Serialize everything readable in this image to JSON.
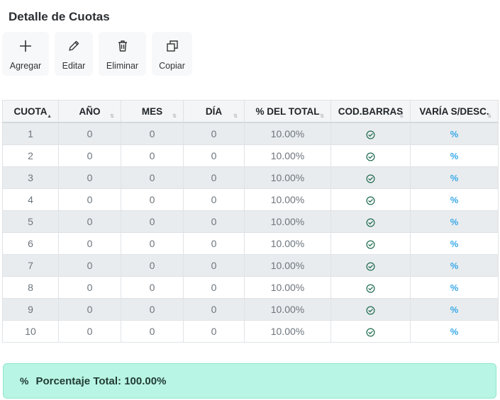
{
  "page": {
    "title": "Detalle de Cuotas"
  },
  "toolbar": {
    "buttons": [
      {
        "label": "Agregar",
        "icon": "plus-icon"
      },
      {
        "label": "Editar",
        "icon": "pencil-icon"
      },
      {
        "label": "Eliminar",
        "icon": "trash-icon"
      },
      {
        "label": "Copiar",
        "icon": "copy-icon"
      }
    ]
  },
  "table": {
    "headers": [
      "CUOTA",
      "AÑO",
      "MES",
      "DÍA",
      "% DEL TOTAL",
      "COD.BARRAS",
      "VARÍA S/DESC."
    ],
    "sorted_column": "CUOTA",
    "rows": [
      {
        "cuota": "1",
        "anio": "0",
        "mes": "0",
        "dia": "0",
        "pct": "10.00%",
        "varia": "%"
      },
      {
        "cuota": "2",
        "anio": "0",
        "mes": "0",
        "dia": "0",
        "pct": "10.00%",
        "varia": "%"
      },
      {
        "cuota": "3",
        "anio": "0",
        "mes": "0",
        "dia": "0",
        "pct": "10.00%",
        "varia": "%"
      },
      {
        "cuota": "4",
        "anio": "0",
        "mes": "0",
        "dia": "0",
        "pct": "10.00%",
        "varia": "%"
      },
      {
        "cuota": "5",
        "anio": "0",
        "mes": "0",
        "dia": "0",
        "pct": "10.00%",
        "varia": "%"
      },
      {
        "cuota": "6",
        "anio": "0",
        "mes": "0",
        "dia": "0",
        "pct": "10.00%",
        "varia": "%"
      },
      {
        "cuota": "7",
        "anio": "0",
        "mes": "0",
        "dia": "0",
        "pct": "10.00%",
        "varia": "%"
      },
      {
        "cuota": "8",
        "anio": "0",
        "mes": "0",
        "dia": "0",
        "pct": "10.00%",
        "varia": "%"
      },
      {
        "cuota": "9",
        "anio": "0",
        "mes": "0",
        "dia": "0",
        "pct": "10.00%",
        "varia": "%"
      },
      {
        "cuota": "10",
        "anio": "0",
        "mes": "0",
        "dia": "0",
        "pct": "10.00%",
        "varia": "%"
      }
    ]
  },
  "footer": {
    "icon_text": "%",
    "text": "Porcentaje Total: 100.00%"
  },
  "colors": {
    "accent": "#39a9ea",
    "footer_bg": "#b9f5e4",
    "check": "#1f6b4f"
  }
}
